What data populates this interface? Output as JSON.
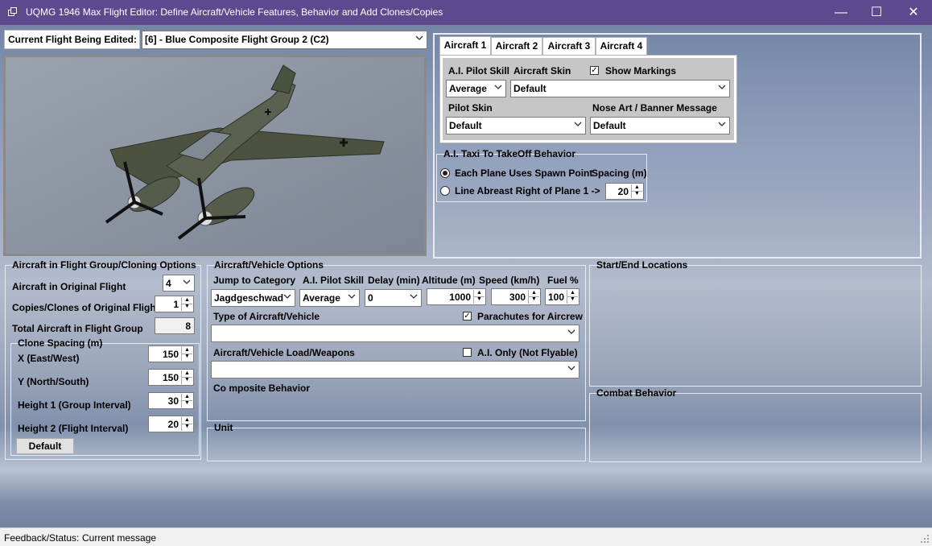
{
  "window": {
    "title": "UQMG 1946 Max Flight Editor:  Define Aircraft/Vehicle Features, Behavior and Add Clones/Copies",
    "minimize": "—",
    "maximize": "☐",
    "close": "✕"
  },
  "header": {
    "current_flight_label": "Current Flight Being Edited:",
    "current_flight_value": "[6] - Blue Composite Flight Group 2 (C2)"
  },
  "tabs": [
    "Aircraft 1",
    "Aircraft 2",
    "Aircraft 3",
    "Aircraft 4"
  ],
  "aircraft_panel": {
    "ai_pilot_skill_label": "A.I. Pilot Skill",
    "ai_pilot_skill_value": "Average",
    "aircraft_skin_label": "Aircraft Skin",
    "aircraft_skin_value": "Default",
    "show_markings_label": "Show Markings",
    "show_markings_checked": true,
    "pilot_skin_label": "Pilot Skin",
    "pilot_skin_value": "Default",
    "nose_art_label": "Nose Art / Banner Message",
    "nose_art_value": "Default"
  },
  "taxi": {
    "title": "A.I. Taxi To TakeOff Behavior",
    "option1": "Each Plane Uses Spawn Point",
    "option2": "Line Abreast Right of Plane 1 ->",
    "spacing_label": "Spacing (m)",
    "spacing_value": "20"
  },
  "cloning": {
    "title": "Aircraft in Flight Group/Cloning Options",
    "original_label": "Aircraft in Original Flight",
    "original_value": "4",
    "copies_label": "Copies/Clones of Original Flight",
    "copies_value": "1",
    "total_label": "Total Aircraft in Flight Group",
    "total_value": "8",
    "spacing_title": "Clone Spacing (m)",
    "x_label": "X (East/West)",
    "x_value": "150",
    "y_label": "Y (North/South)",
    "y_value": "150",
    "h1_label": "Height 1 (Group Interval)",
    "h1_value": "30",
    "h2_label": "Height 2 (Flight Interval)",
    "h2_value": "20",
    "default_button": "Default"
  },
  "options": {
    "title": "Aircraft/Vehicle Options",
    "jump_label": "Jump to Category",
    "jump_value": "Jagdgeschwad",
    "skill_label": "A.I. Pilot Skill",
    "skill_value": "Average",
    "delay_label": "Delay (min)",
    "delay_value": "0",
    "altitude_label": "Altitude (m)",
    "altitude_value": "1000",
    "speed_label": "Speed (km/h)",
    "speed_value": "300",
    "fuel_label": "Fuel %",
    "fuel_value": "100",
    "type_label": "Type of Aircraft/Vehicle",
    "parachutes_label": "Parachutes for Aircrew",
    "parachutes_checked": true,
    "load_label": "Aircraft/Vehicle Load/Weapons",
    "ai_only_label": "A.I. Only (Not Flyable)",
    "ai_only_checked": false,
    "composite_label": "Co mposite Behavior"
  },
  "unit": {
    "title": "Unit"
  },
  "start_end": {
    "title": "Start/End Locations"
  },
  "combat": {
    "title": "Combat Behavior"
  },
  "status": {
    "label": "Feedback/Status:",
    "message": "Current message"
  }
}
